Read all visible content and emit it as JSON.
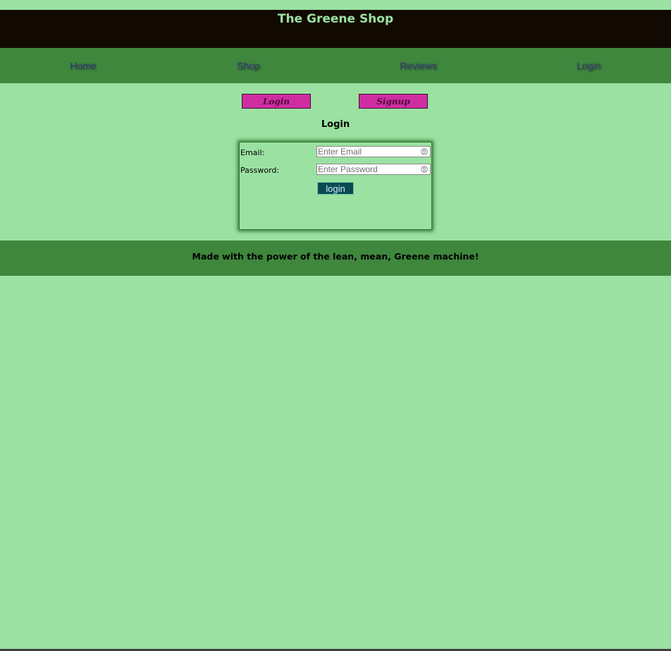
{
  "header": {
    "title": "The Greene Shop"
  },
  "nav": {
    "items": [
      {
        "label": "Home"
      },
      {
        "label": "Shop"
      },
      {
        "label": "Reviews"
      },
      {
        "label": "Login"
      }
    ]
  },
  "auth_tabs": {
    "login_label": "Login",
    "signup_label": "Signup"
  },
  "login_form": {
    "title": "Login",
    "email": {
      "label": "Email:",
      "placeholder": "Enter Email",
      "value": ""
    },
    "password": {
      "label": "Password:",
      "placeholder": "Enter Password",
      "value": ""
    },
    "submit_label": "login"
  },
  "footer": {
    "text": "Made with the power of the lean, mean, Greene machine!"
  },
  "icons": {
    "autofill": "autofill-icon"
  },
  "colors": {
    "page_bg": "#9be1a2",
    "header_bg": "#120a02",
    "nav_bg": "#3f873d",
    "tab_button_bg": "#d02da3",
    "submit_bg": "#0b4a52"
  }
}
